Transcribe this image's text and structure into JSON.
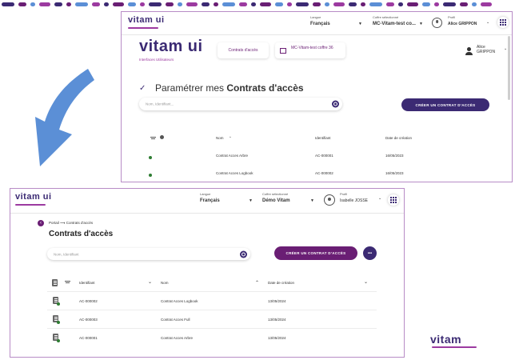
{
  "top_screen": {
    "logo": "vitam ui",
    "logo_sub": "Interfaces Utilisateurs",
    "header": {
      "langue_label": "Langue",
      "langue_value": "Français",
      "coffre_label": "Coffre sélectionné",
      "coffre_value": "MC-Vitam-test co...",
      "profil_label": "Profil",
      "profil_value": "Alice GRIPPON"
    },
    "subheader": {
      "tab_contrats": "Contrats d'accès",
      "coffre_tab": "MC-Vitam-test coffre 36",
      "user_name": "Alice GRIPPON"
    },
    "title_prefix": "Paramétrer mes ",
    "title_bold": "Contrats d'accès",
    "search_placeholder": "Nom, Identifiant...",
    "create_button": "CRÉER UN CONTRAT D'ACCÈS",
    "columns": [
      "Nom",
      "Identifiant",
      "Date de création"
    ],
    "rows": [
      {
        "nom": "Contrat Acces Arbre",
        "id": "AC-000001",
        "date": "16/05/2023"
      },
      {
        "nom": "Contrat Acces Logbook",
        "id": "AC-000002",
        "date": "16/05/2023"
      }
    ]
  },
  "bottom_screen": {
    "logo": "vitam ui",
    "header": {
      "langue_label": "Langue",
      "langue_value": "Français",
      "coffre_label": "Coffre sélectionné",
      "coffre_value": "Démo Vitam",
      "profil_label": "Profil",
      "profil_value": "Isabelle JOSSE"
    },
    "breadcrumb_portal": "Portail",
    "breadcrumb_current": "Contrats d'accès",
    "page_title": "Contrats d'accès",
    "search_placeholder": "Nom, Identifiant",
    "create_button": "CRÉER UN CONTRAT D'ACCÈS",
    "more_button": "•••",
    "columns": [
      "Identifiant",
      "Nom",
      "Date de création"
    ],
    "rows": [
      {
        "id": "AC-000002",
        "nom": "Contrat Acces Logbook",
        "date": "13/05/2024"
      },
      {
        "id": "AC-000003",
        "nom": "Contrat Acces Full",
        "date": "13/05/2024"
      },
      {
        "id": "AC-000001",
        "nom": "Contrat Acces Arbre",
        "date": "13/05/2024"
      }
    ]
  },
  "corner_logo": "vitam",
  "colors": {
    "brand_dark": "#3b2a73",
    "brand_purple": "#9c3aa0",
    "status_green": "#2e7d32",
    "arrow_blue": "#5b8fd6"
  }
}
